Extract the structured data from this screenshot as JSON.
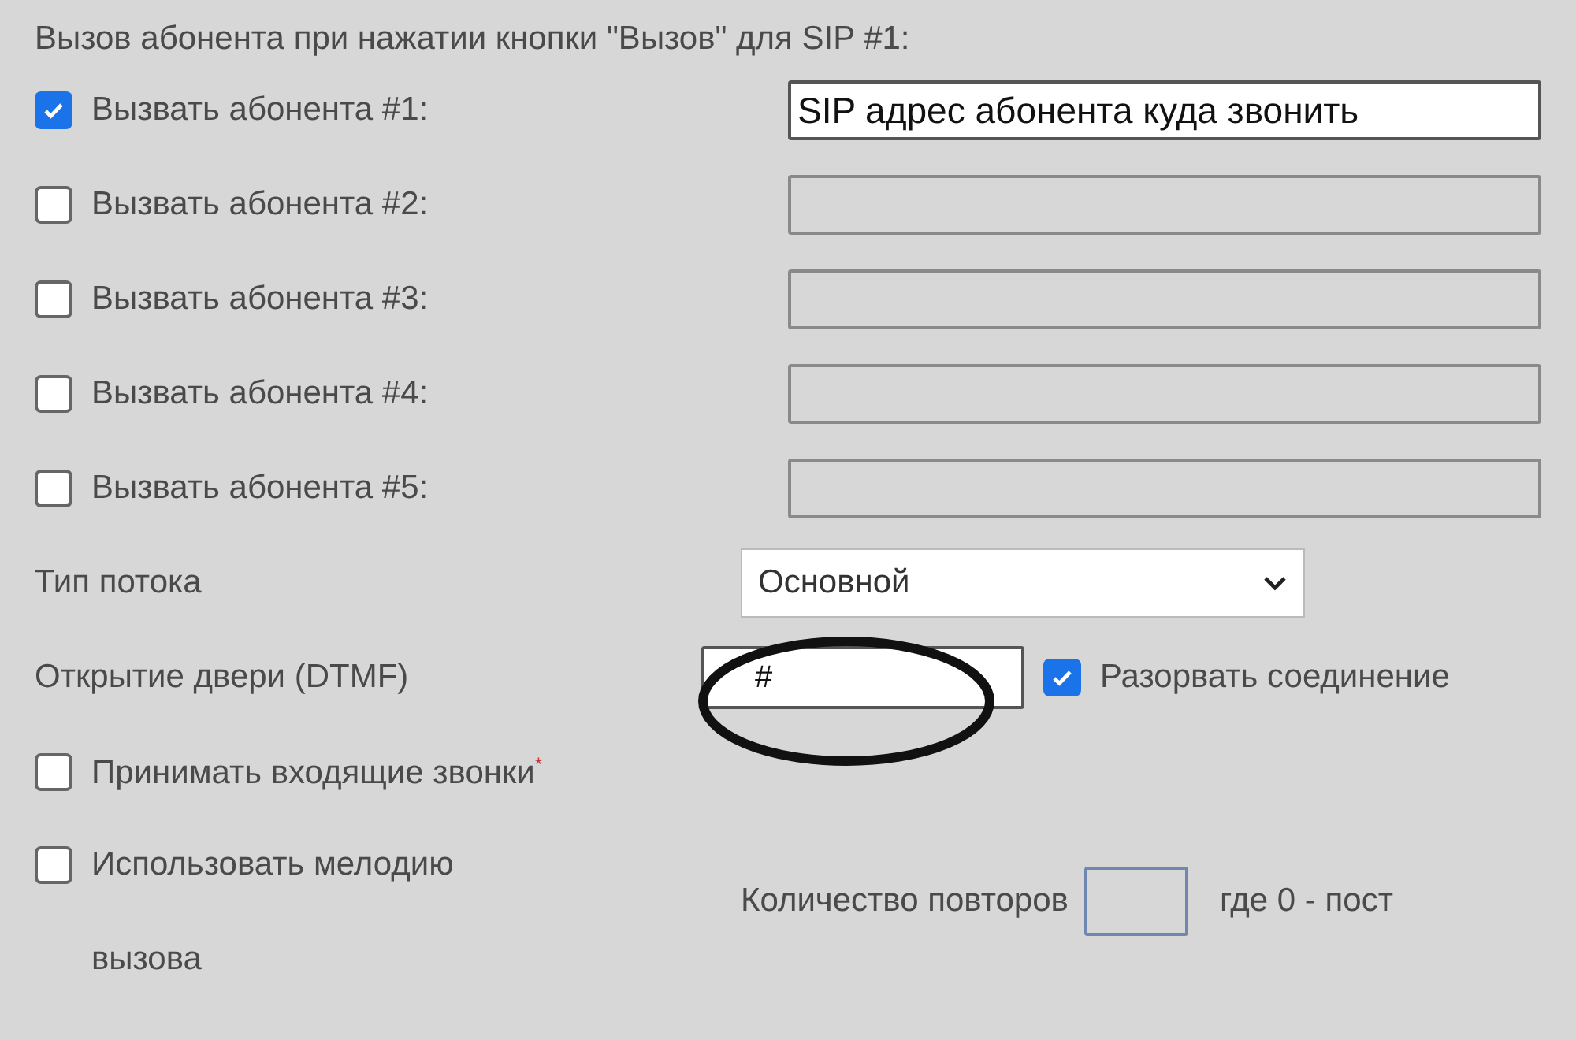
{
  "heading": "Вызов абонента при нажатии кнопки \"Вызов\" для SIP #1:",
  "subscribers": [
    {
      "label": "Вызвать абонента #1:",
      "checked": true,
      "value": "SIP адрес абонента куда звонить",
      "disabled": false
    },
    {
      "label": "Вызвать абонента #2:",
      "checked": false,
      "disabled": true
    },
    {
      "label": "Вызвать абонента #3:",
      "checked": false,
      "disabled": true
    },
    {
      "label": "Вызвать абонента #4:",
      "checked": false,
      "disabled": true
    },
    {
      "label": "Вызвать абонента #5:",
      "checked": false,
      "disabled": true
    }
  ],
  "stream_type": {
    "label": "Тип потока",
    "value": "Основной"
  },
  "door_open": {
    "label": "Открытие двери (DTMF)",
    "value": "#",
    "hangup": {
      "label": "Разорвать соединение",
      "checked": true
    }
  },
  "incoming": {
    "label": "Принимать входящие звонки$^{*}$",
    "checked": false
  },
  "melody": {
    "label": "Использовать мелодию вызова",
    "checked": false,
    "repeat_label": "Количество повторов",
    "repeat_hint": "где 0 - пост"
  }
}
